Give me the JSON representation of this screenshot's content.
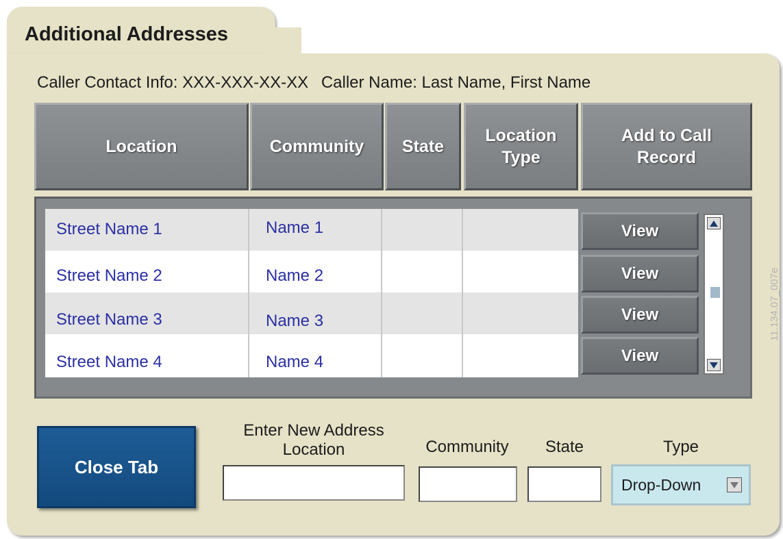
{
  "tab": {
    "title": "Additional Addresses"
  },
  "caller": {
    "contact_label": "Caller Contact Info: XXX-XXX-XX-XX",
    "name_label": "Caller Name: Last Name, First Name"
  },
  "table": {
    "headers": [
      "Location",
      "Community",
      "State",
      "Location Type",
      "Add to Call Record"
    ],
    "rows": [
      {
        "location": "Street Name 1",
        "community": "Name 1",
        "state": "",
        "location_type": "",
        "action": "View"
      },
      {
        "location": "Street Name 2",
        "community": "Name 2",
        "state": "",
        "location_type": "",
        "action": "View"
      },
      {
        "location": "Street Name 3",
        "community": "Name 3",
        "state": "",
        "location_type": "",
        "action": "View"
      },
      {
        "location": "Street Name 4",
        "community": "Name 4",
        "state": "",
        "location_type": "",
        "action": "View"
      }
    ]
  },
  "form": {
    "close_button": "Close Tab",
    "address_label": "Enter New Address Location",
    "community_label": "Community",
    "state_label": "State",
    "type_label": "Type",
    "address_value": "",
    "community_value": "",
    "state_value": "",
    "type_value": "Drop-Down"
  },
  "watermark": "11.134.07_007e",
  "colors": {
    "panel_bg": "#e6e2c7",
    "header_gray": "#85898c",
    "link_blue": "#2b2fa3",
    "close_button_blue": "#1a5590",
    "dropdown_bg": "#c9e8ee"
  }
}
